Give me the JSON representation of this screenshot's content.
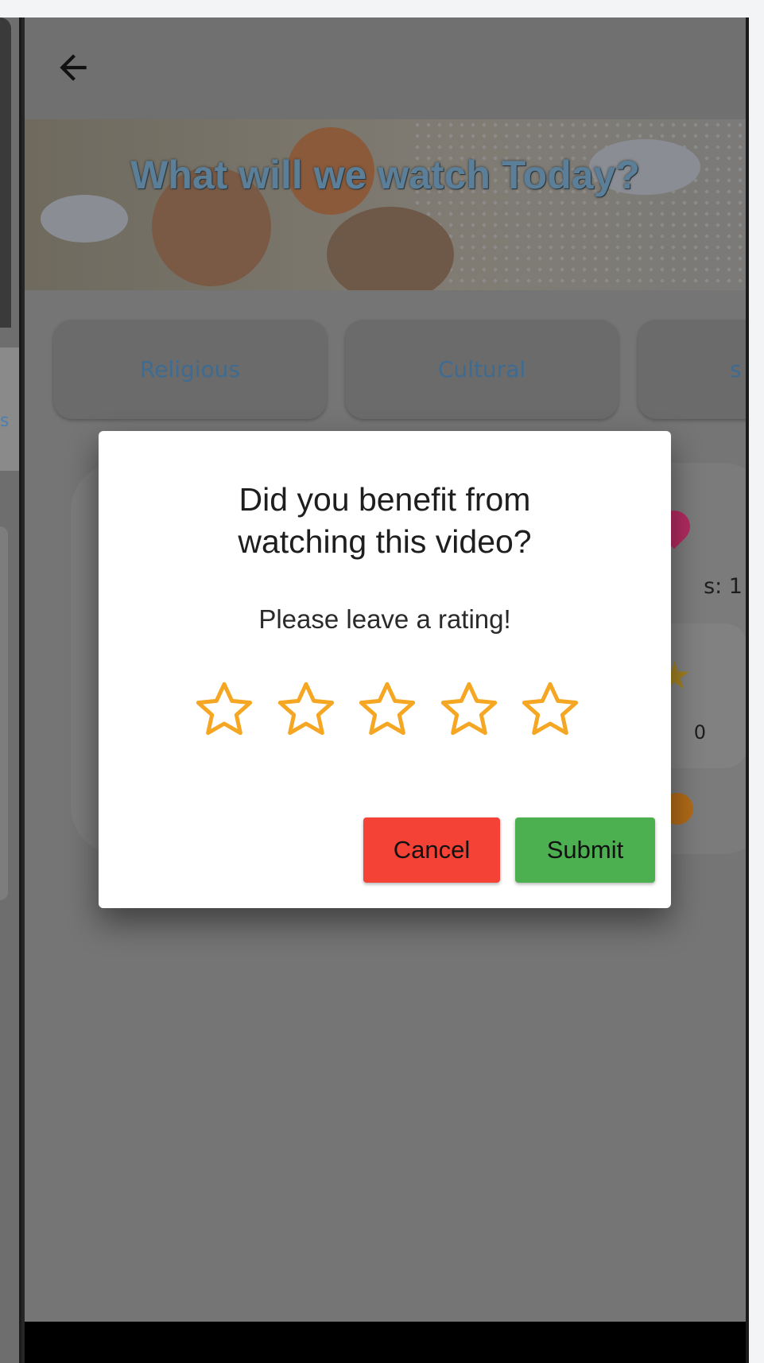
{
  "banner": {
    "title": "What will we watch Today?"
  },
  "categories": [
    {
      "label": "Religious"
    },
    {
      "label": "Cultural"
    },
    {
      "label": "s"
    }
  ],
  "background_card": {
    "likes_fragment": "s: 1",
    "rating_fragment": "0"
  },
  "left_edge": {
    "fragment": "s"
  },
  "dialog": {
    "title": "Did you benefit from watching this video?",
    "subtitle": "Please leave a rating!",
    "rating": {
      "max": 5,
      "value": 0
    },
    "cancel_label": "Cancel",
    "submit_label": "Submit"
  },
  "colors": {
    "star": "#f5a623",
    "cancel": "#f44336",
    "submit": "#4caf50",
    "scrim_text_blue": "#3e6b91"
  }
}
